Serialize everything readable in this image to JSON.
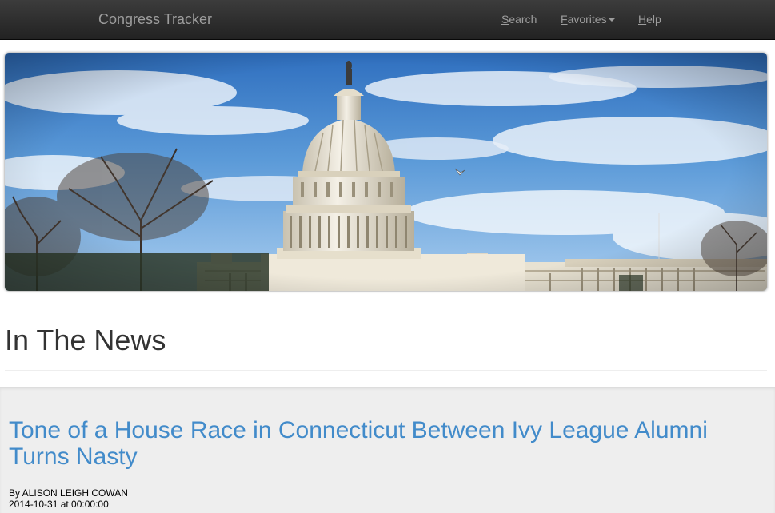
{
  "navbar": {
    "brand": "Congress Tracker",
    "links": [
      {
        "first": "S",
        "rest": "earch"
      },
      {
        "first": "F",
        "rest": "avorites"
      },
      {
        "first": "H",
        "rest": "elp"
      }
    ]
  },
  "banner": {
    "subject": "United States Capitol building under a blue sky"
  },
  "section": {
    "title": "In The News"
  },
  "article": {
    "headline": "Tone of a House Race in Connecticut Between Ivy League Alumni Turns Nasty",
    "byline": "By ALISON LEIGH COWAN",
    "timestamp": "2014-10-31 at 00:00:00"
  },
  "colors": {
    "navbar": "#222222",
    "nav_text": "#9d9d9d",
    "link": "#428bca",
    "well": "#eeeeee"
  }
}
